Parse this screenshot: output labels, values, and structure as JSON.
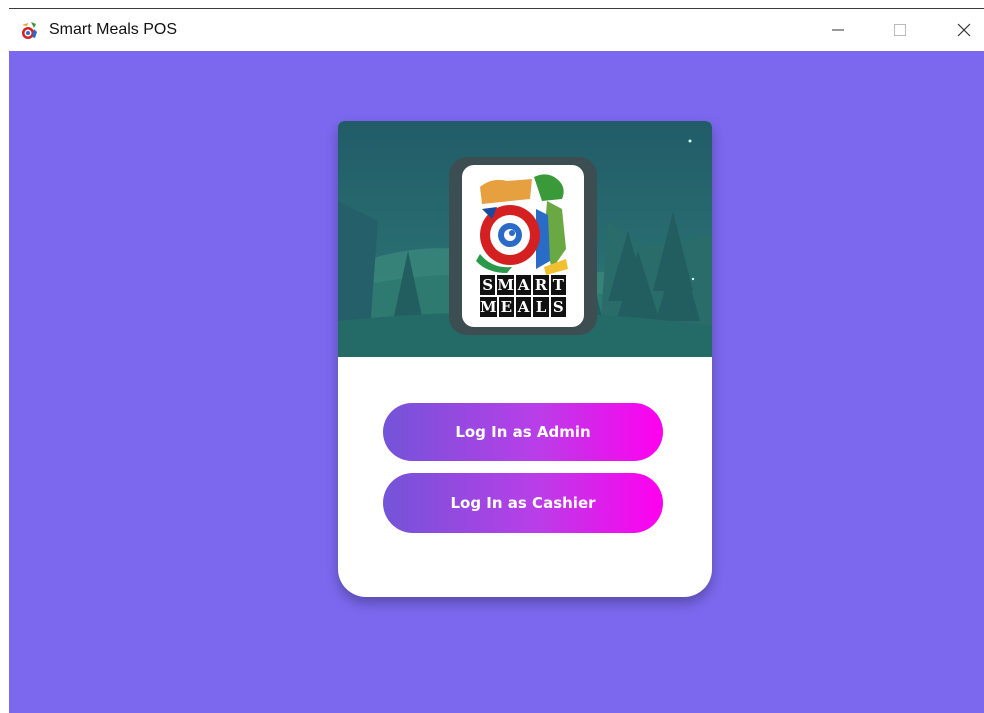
{
  "window": {
    "title": "Smart Meals POS",
    "background_color": "#7b68ee",
    "controls": {
      "minimize": "minimize-icon",
      "maximize": "maximize-icon",
      "close": "close-icon"
    }
  },
  "card": {
    "logo": {
      "word1": [
        "S",
        "M",
        "A",
        "R",
        "T"
      ],
      "word2": [
        "M",
        "E",
        "A",
        "L",
        "S"
      ]
    },
    "buttons": {
      "admin_label": "Log In as Admin",
      "cashier_label": "Log In as Cashier"
    },
    "button_gradient": [
      "#7354d8",
      "#ff00ef"
    ]
  }
}
